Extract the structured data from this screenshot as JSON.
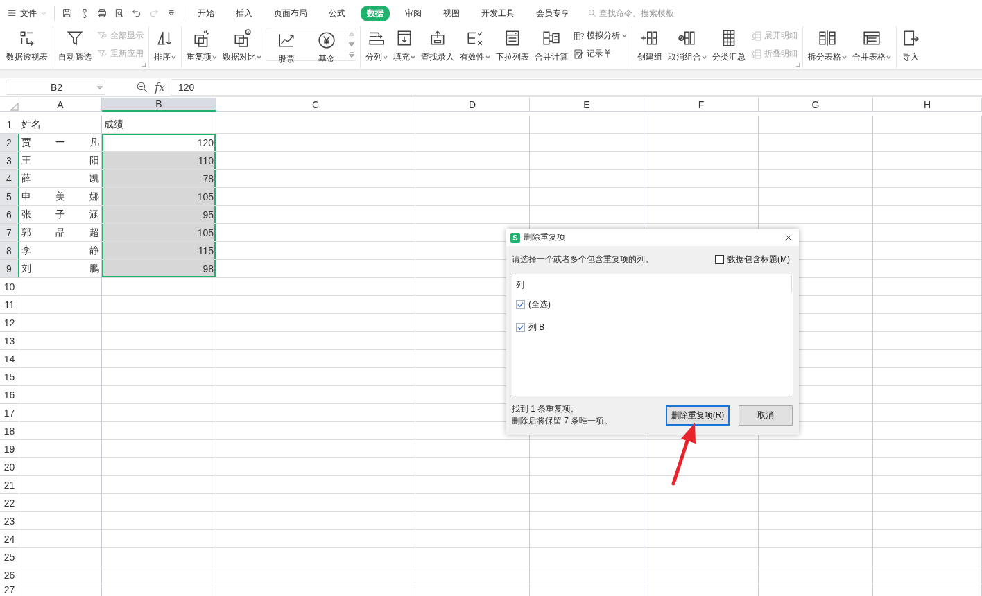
{
  "menu_bar": {
    "file_menu": "文件",
    "tabs": [
      {
        "label": "开始",
        "selected": false
      },
      {
        "label": "插入",
        "selected": false
      },
      {
        "label": "页面布局",
        "selected": false
      },
      {
        "label": "公式",
        "selected": false
      },
      {
        "label": "数据",
        "selected": true
      },
      {
        "label": "审阅",
        "selected": false
      },
      {
        "label": "视图",
        "selected": false
      },
      {
        "label": "开发工具",
        "selected": false
      },
      {
        "label": "会员专享",
        "selected": false
      }
    ],
    "search": {
      "placeholder": "查找命令、搜索模板"
    }
  },
  "ribbon": {
    "groups": [
      {
        "launcher": false,
        "items": [
          {
            "kind": "large",
            "label": "数据透视表",
            "dropdown": false
          }
        ]
      },
      {
        "launcher": true,
        "items": [
          {
            "kind": "large",
            "label": "自动筛选",
            "dropdown": false
          },
          {
            "kind": "stack",
            "items": [
              {
                "label": "全部显示",
                "disabled": true,
                "dropdown": false
              },
              {
                "label": "重新应用",
                "disabled": true,
                "dropdown": false
              }
            ]
          }
        ]
      },
      {
        "launcher": false,
        "items": [
          {
            "kind": "large",
            "label": "排序",
            "dropdown": true
          }
        ]
      },
      {
        "launcher": false,
        "items": [
          {
            "kind": "large",
            "label": "重复项",
            "dropdown": true
          },
          {
            "kind": "large",
            "label": "数据对比",
            "dropdown": true
          },
          {
            "kind": "gallery",
            "items": [
              {
                "label": "股票"
              },
              {
                "label": "基金"
              }
            ]
          }
        ]
      },
      {
        "launcher": false,
        "items": [
          {
            "kind": "large",
            "label": "分列",
            "dropdown": true
          },
          {
            "kind": "large",
            "label": "填充",
            "dropdown": true
          },
          {
            "kind": "large",
            "label": "查找录入",
            "dropdown": false
          },
          {
            "kind": "large",
            "label": "有效性",
            "dropdown": true
          },
          {
            "kind": "large",
            "label": "下拉列表",
            "dropdown": false
          },
          {
            "kind": "large",
            "label": "合并计算",
            "dropdown": false
          },
          {
            "kind": "stack",
            "items": [
              {
                "label": "模拟分析",
                "disabled": false,
                "dropdown": true
              },
              {
                "label": "记录单",
                "disabled": false,
                "dropdown": false
              }
            ]
          }
        ]
      },
      {
        "launcher": true,
        "items": [
          {
            "kind": "large",
            "label": "创建组",
            "dropdown": false
          },
          {
            "kind": "large",
            "label": "取消组合",
            "dropdown": true
          },
          {
            "kind": "large",
            "label": "分类汇总",
            "dropdown": false
          },
          {
            "kind": "stack",
            "items": [
              {
                "label": "展开明细",
                "disabled": true,
                "dropdown": false
              },
              {
                "label": "折叠明细",
                "disabled": true,
                "dropdown": false
              }
            ]
          }
        ]
      },
      {
        "launcher": false,
        "items": [
          {
            "kind": "large",
            "label": "拆分表格",
            "dropdown": true
          },
          {
            "kind": "large",
            "label": "合并表格",
            "dropdown": true
          }
        ]
      },
      {
        "launcher": false,
        "items": [
          {
            "kind": "large",
            "label": "导入",
            "dropdown": false
          }
        ]
      }
    ]
  },
  "formula_bar": {
    "name_box": "B2",
    "function_label": "fx",
    "value": "120"
  },
  "sheet": {
    "columns": [
      {
        "label": "A",
        "selected": false
      },
      {
        "label": "B",
        "selected": true
      },
      {
        "label": "C",
        "selected": false
      },
      {
        "label": "D",
        "selected": false
      },
      {
        "label": "E",
        "selected": false
      },
      {
        "label": "F",
        "selected": false
      },
      {
        "label": "G",
        "selected": false
      },
      {
        "label": "H",
        "selected": false
      }
    ],
    "rows": [
      {
        "label": "1",
        "selected": false,
        "cells": [
          {
            "text": "姓名",
            "selected": false
          },
          {
            "text": "成绩",
            "selected": false
          }
        ]
      },
      {
        "label": "2",
        "selected": true,
        "cells": [
          {
            "text": "贾一凡",
            "selected": false
          },
          {
            "text": "120",
            "selected": true
          }
        ]
      },
      {
        "label": "3",
        "selected": true,
        "cells": [
          {
            "text": "王阳",
            "selected": false
          },
          {
            "text": "110",
            "selected": true
          }
        ]
      },
      {
        "label": "4",
        "selected": true,
        "cells": [
          {
            "text": "薛凯",
            "selected": false
          },
          {
            "text": "78",
            "selected": true
          }
        ]
      },
      {
        "label": "5",
        "selected": true,
        "cells": [
          {
            "text": "申美娜",
            "selected": false
          },
          {
            "text": "105",
            "selected": true
          }
        ]
      },
      {
        "label": "6",
        "selected": true,
        "cells": [
          {
            "text": "张子涵",
            "selected": false
          },
          {
            "text": "95",
            "selected": true
          }
        ]
      },
      {
        "label": "7",
        "selected": true,
        "cells": [
          {
            "text": "郭品超",
            "selected": false
          },
          {
            "text": "105",
            "selected": true
          }
        ]
      },
      {
        "label": "8",
        "selected": true,
        "cells": [
          {
            "text": "李静",
            "selected": false
          },
          {
            "text": "115",
            "selected": true
          }
        ]
      },
      {
        "label": "9",
        "selected": true,
        "cells": [
          {
            "text": "刘鹏",
            "selected": false
          },
          {
            "text": "98",
            "selected": true
          }
        ]
      },
      {
        "label": "10",
        "selected": false
      },
      {
        "label": "11",
        "selected": false
      },
      {
        "label": "12",
        "selected": false
      },
      {
        "label": "13",
        "selected": false
      },
      {
        "label": "14",
        "selected": false
      },
      {
        "label": "15",
        "selected": false
      },
      {
        "label": "16",
        "selected": false
      },
      {
        "label": "17",
        "selected": false
      },
      {
        "label": "18",
        "selected": false
      },
      {
        "label": "19",
        "selected": false
      },
      {
        "label": "20",
        "selected": false
      },
      {
        "label": "21",
        "selected": false
      },
      {
        "label": "22",
        "selected": false
      },
      {
        "label": "23",
        "selected": false
      },
      {
        "label": "24",
        "selected": false
      },
      {
        "label": "25",
        "selected": false
      },
      {
        "label": "26",
        "selected": false
      },
      {
        "label": "27",
        "selected": false
      }
    ]
  },
  "dialog": {
    "icon_letter": "S",
    "title": "删除重复项",
    "instruction": "请选择一个或者多个包含重复项的列。",
    "header_checkbox": {
      "label": "数据包含标题(M)",
      "checked": false
    },
    "list_header": "列",
    "columns": [
      {
        "label": "(全选)",
        "checked": true
      },
      {
        "label": "列 B",
        "checked": true
      }
    ],
    "summary": [
      "找到 1 条重复项;",
      "删除后将保留 7 条唯一项。"
    ],
    "buttons": [
      {
        "label": "删除重复项(R)",
        "focused": true
      },
      {
        "label": "取消",
        "focused": false
      }
    ]
  }
}
